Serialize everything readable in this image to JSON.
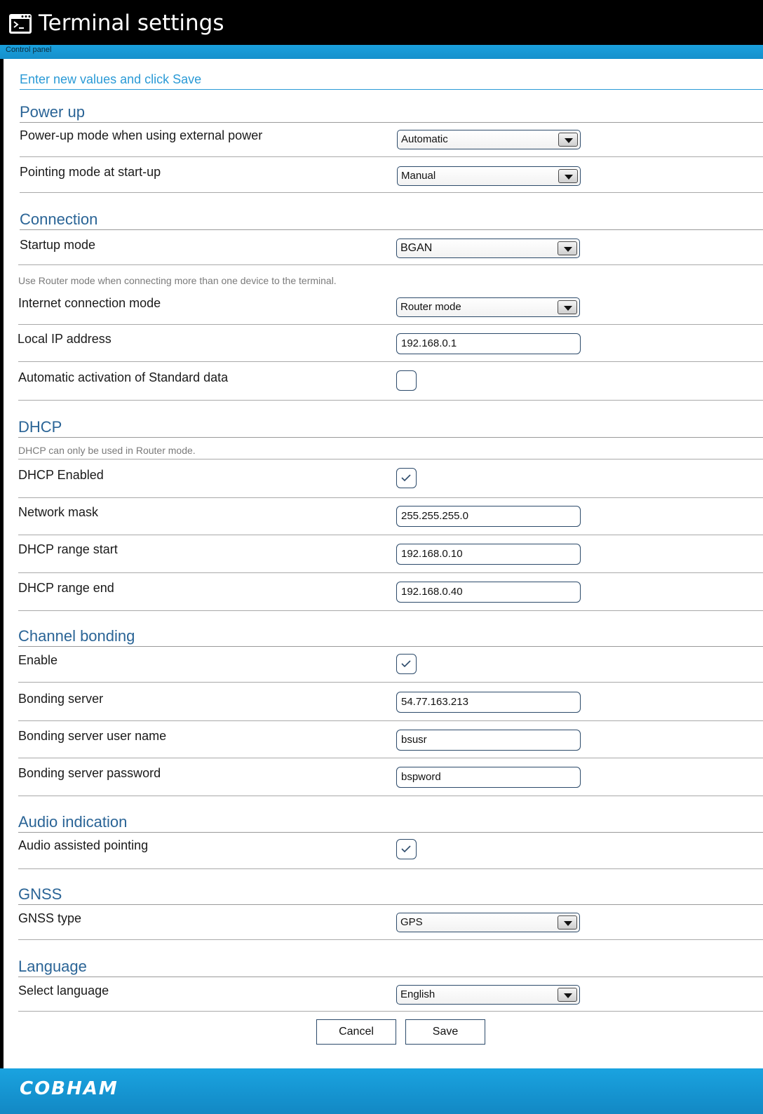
{
  "window": {
    "title": "Terminal settings",
    "breadcrumb": "Control panel",
    "icon": "terminal-icon"
  },
  "intro": "Enter new values and click Save",
  "sections": {
    "power_up": {
      "title": "Power up",
      "power_mode_label": "Power-up mode when using external power",
      "power_mode_value": "Automatic",
      "pointing_label": "Pointing mode at start-up",
      "pointing_value": "Manual"
    },
    "connection": {
      "title": "Connection",
      "startup_label": "Startup mode",
      "startup_value": "BGAN",
      "router_note": "Use Router mode when connecting more than one device to the terminal.",
      "internet_label": "Internet connection mode",
      "internet_value": "Router mode",
      "local_ip_label": "Local IP address",
      "local_ip_value": "192.168.0.1",
      "auto_activation_label": "Automatic activation of Standard data",
      "auto_activation_checked": false
    },
    "dhcp": {
      "title": "DHCP",
      "note": "DHCP can only be used in Router mode.",
      "enabled_label": "DHCP Enabled",
      "enabled_checked": true,
      "mask_label": "Network mask",
      "mask_value": "255.255.255.0",
      "range_start_label": "DHCP range start",
      "range_start_value": "192.168.0.10",
      "range_end_label": "DHCP range end",
      "range_end_value": "192.168.0.40"
    },
    "channel_bonding": {
      "title": "Channel bonding",
      "enable_label": "Enable",
      "enable_checked": true,
      "server_label": "Bonding server",
      "server_value": "54.77.163.213",
      "user_label": "Bonding server user name",
      "user_value": "bsusr",
      "password_label": "Bonding server password",
      "password_value": "bspword"
    },
    "audio": {
      "title": "Audio indication",
      "assisted_label": "Audio assisted pointing",
      "assisted_checked": true
    },
    "gnss": {
      "title": "GNSS",
      "type_label": "GNSS type",
      "type_value": "GPS"
    },
    "language": {
      "title": "Language",
      "select_label": "Select language",
      "select_value": "English"
    }
  },
  "buttons": {
    "cancel": "Cancel",
    "save": "Save"
  },
  "footer": {
    "brand": "COBHAM"
  },
  "colors": {
    "accent_blue": "#1aa0dd",
    "section_title": "#2a6496",
    "title_bar": "#000000"
  }
}
